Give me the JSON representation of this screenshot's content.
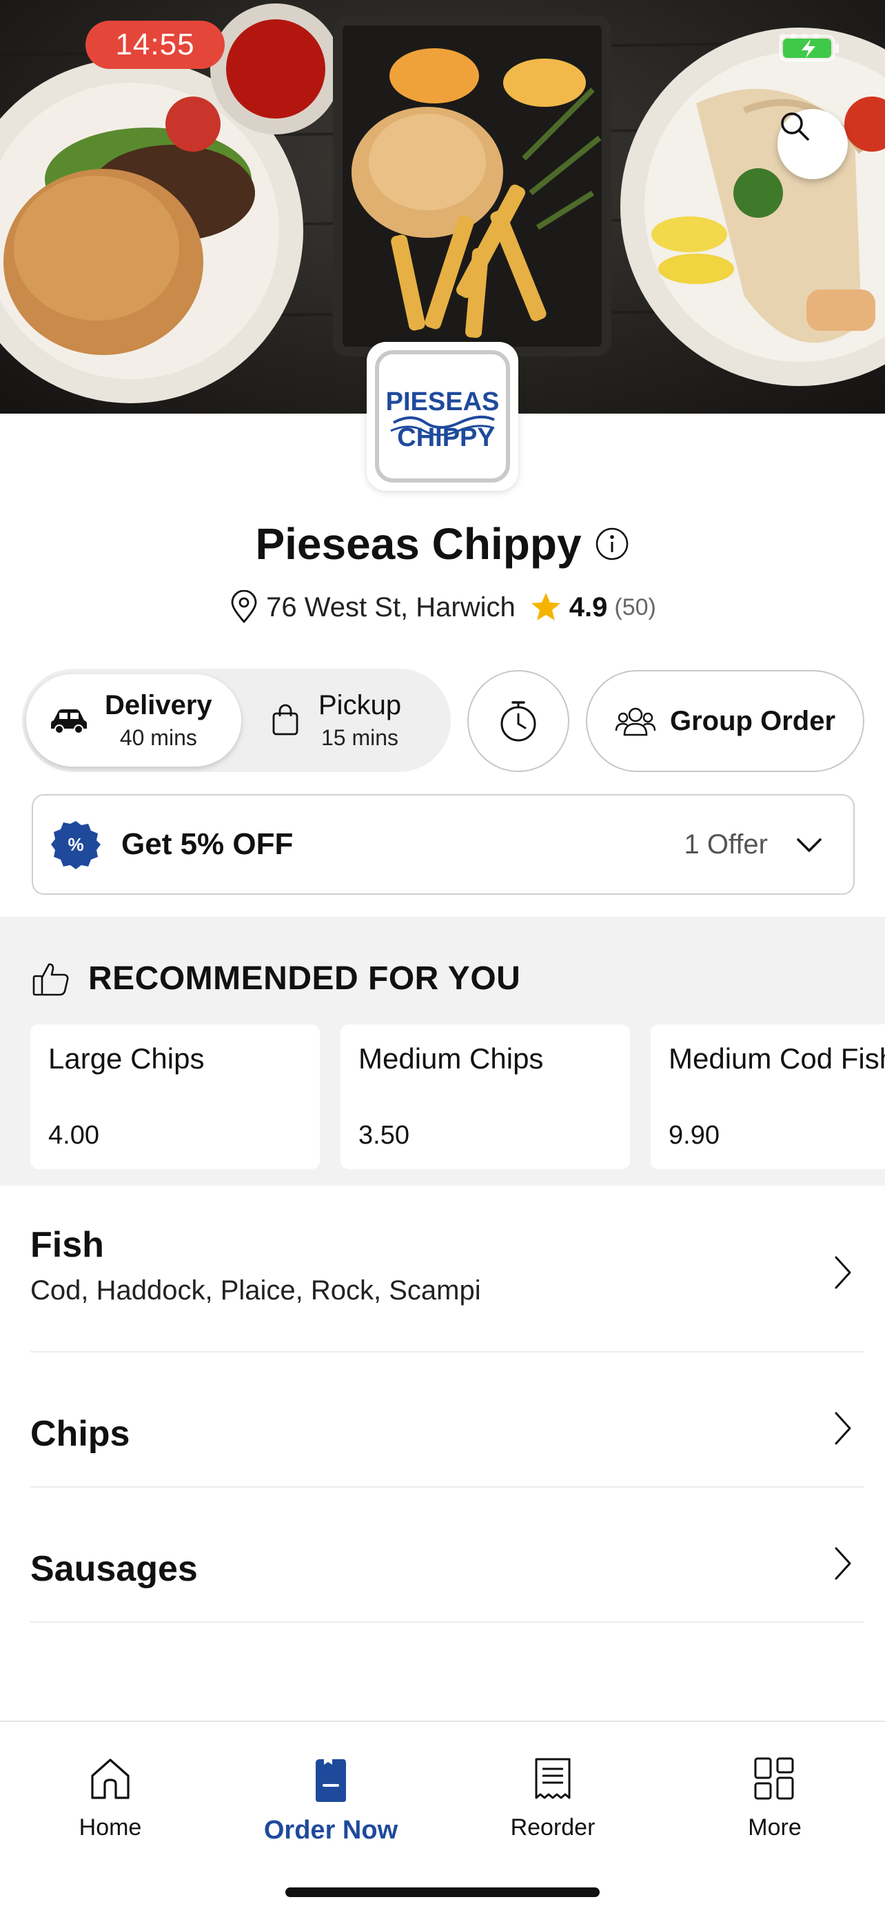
{
  "status_bar": {
    "time": "14:55"
  },
  "store": {
    "name": "Pieseas Chippy",
    "address": "76 West St, Harwich",
    "rating": "4.9",
    "rating_count": "(50)",
    "logo_line1": "PIESEAS",
    "logo_line2": "CHIPPY"
  },
  "modes": {
    "delivery": {
      "label": "Delivery",
      "time": "40 mins"
    },
    "pickup": {
      "label": "Pickup",
      "time": "15 mins"
    },
    "group_order": "Group Order"
  },
  "offer": {
    "title": "Get 5% OFF",
    "count": "1 Offer",
    "badge_symbol": "%"
  },
  "recommended": {
    "title": "RECOMMENDED FOR YOU",
    "items": [
      {
        "name": "Large Chips",
        "price": "4.00"
      },
      {
        "name": "Medium Chips",
        "price": "3.50"
      },
      {
        "name": "Medium Cod Fish",
        "price": "9.90"
      }
    ]
  },
  "categories": [
    {
      "name": "Fish",
      "description": "Cod, Haddock, Plaice, Rock, Scampi"
    },
    {
      "name": "Chips",
      "description": ""
    },
    {
      "name": "Sausages",
      "description": ""
    }
  ],
  "bottom_nav": [
    {
      "label": "Home",
      "icon": "home-icon"
    },
    {
      "label": "Order Now",
      "icon": "order-icon",
      "active": true
    },
    {
      "label": "Reorder",
      "icon": "receipt-icon"
    },
    {
      "label": "More",
      "icon": "grid-icon"
    }
  ],
  "colors": {
    "brand_blue": "#1f4a9c",
    "status_red": "#e5463a",
    "star": "#f5b400"
  }
}
